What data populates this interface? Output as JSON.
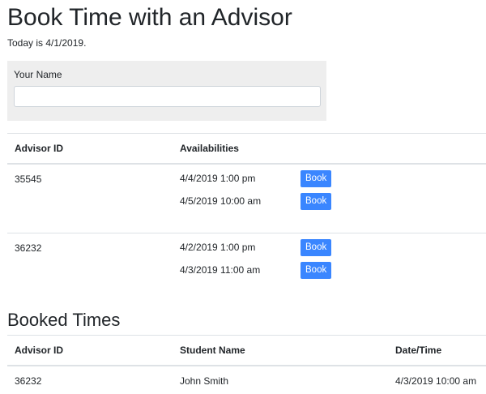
{
  "page": {
    "title": "Book Time with an Advisor",
    "today_text": "Today is 4/1/2019."
  },
  "name_form": {
    "label": "Your Name",
    "value": "",
    "placeholder": ""
  },
  "advisors_table": {
    "headers": {
      "advisor_id": "Advisor ID",
      "availabilities": "Availabilities"
    },
    "rows": [
      {
        "advisor_id": "35545",
        "slots": [
          {
            "time": "4/4/2019 1:00 pm",
            "button": "Book"
          },
          {
            "time": "4/5/2019 10:00 am",
            "button": "Book"
          }
        ]
      },
      {
        "advisor_id": "36232",
        "slots": [
          {
            "time": "4/2/2019 1:00 pm",
            "button": "Book"
          },
          {
            "time": "4/3/2019 11:00 am",
            "button": "Book"
          }
        ]
      }
    ]
  },
  "booked": {
    "title": "Booked Times",
    "headers": {
      "advisor_id": "Advisor ID",
      "student_name": "Student Name",
      "datetime": "Date/Time"
    },
    "rows": [
      {
        "advisor_id": "36232",
        "student_name": "John Smith",
        "datetime": "4/3/2019 10:00 am"
      }
    ]
  },
  "colors": {
    "accent": "#3a86ff",
    "panel_bg": "#eeeeee",
    "border": "#dee2e6"
  }
}
